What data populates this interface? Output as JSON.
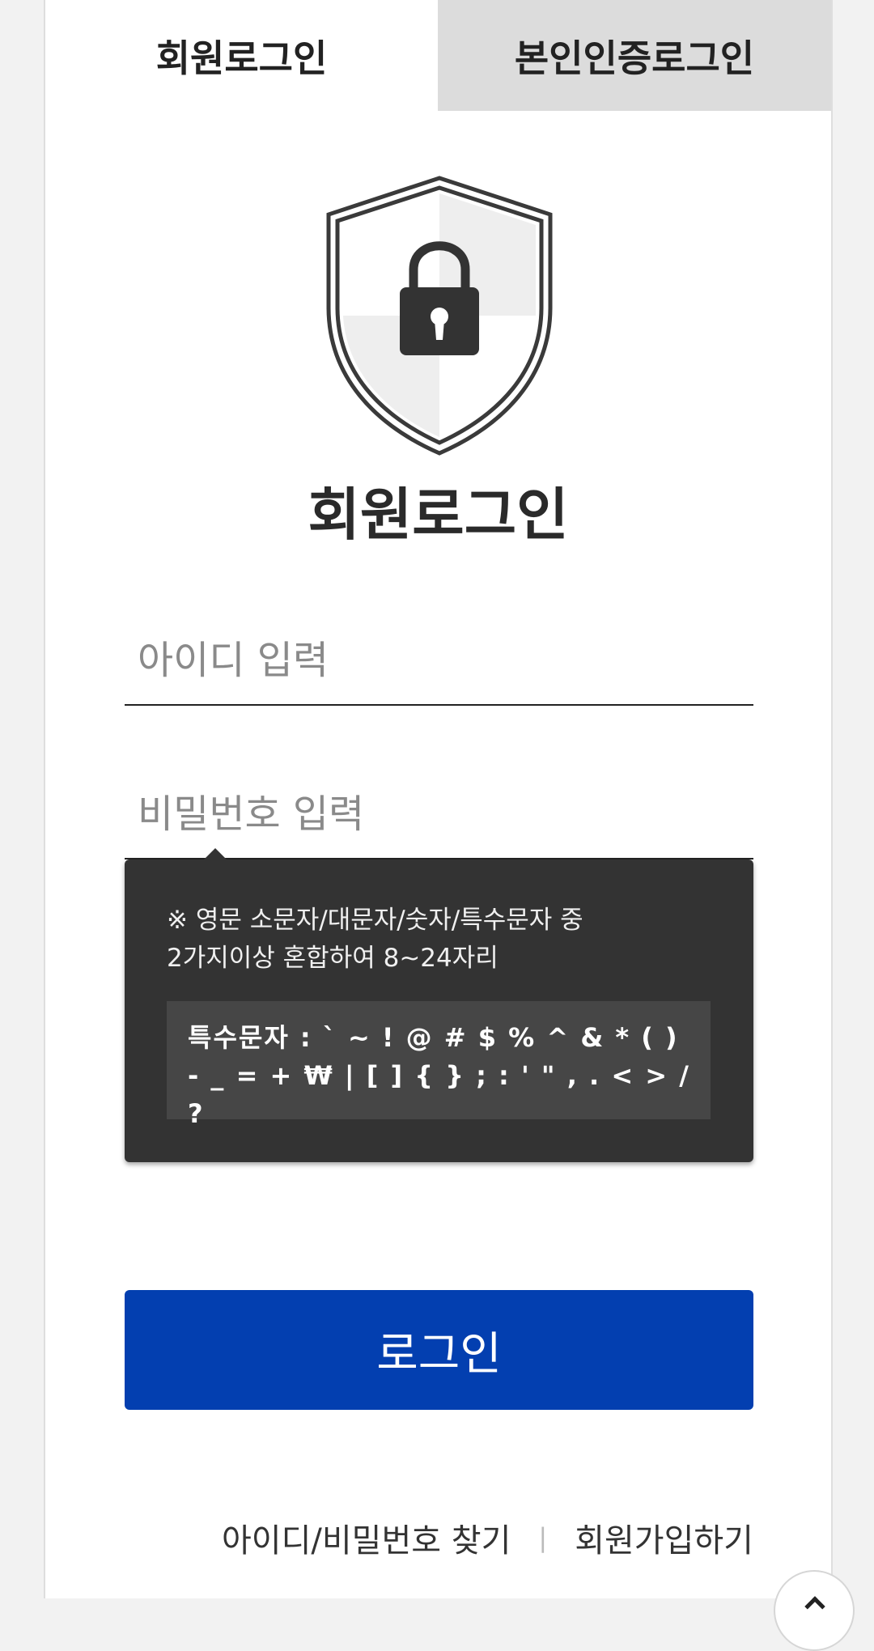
{
  "tabs": {
    "member_login": "회원로그인",
    "identity_login": "본인인증로그인"
  },
  "page": {
    "title": "회원로그인",
    "shield_icon": "shield-lock-icon"
  },
  "form": {
    "id_placeholder": "아이디 입력",
    "password_placeholder": "비밀번호 입력",
    "login_label": "로그인"
  },
  "tooltip": {
    "rule_line1": "※ 영문 소문자/대문자/숫자/특수문자 중",
    "rule_line2": "2가지이상 혼합하여 8~24자리",
    "special_chars": "특수문자 : ` ~ ! @ # $ % ^ & * ( ) - _ = + ₩ | [ ] { } ; : ' \" , . < > / ?"
  },
  "links": {
    "find_account": "아이디/비밀번호 찾기",
    "separator": "|",
    "signup": "회원가입하기"
  },
  "colors": {
    "primary": "#033fb0",
    "tooltip_bg": "#333333",
    "inactive_tab": "#dcdcdc"
  }
}
